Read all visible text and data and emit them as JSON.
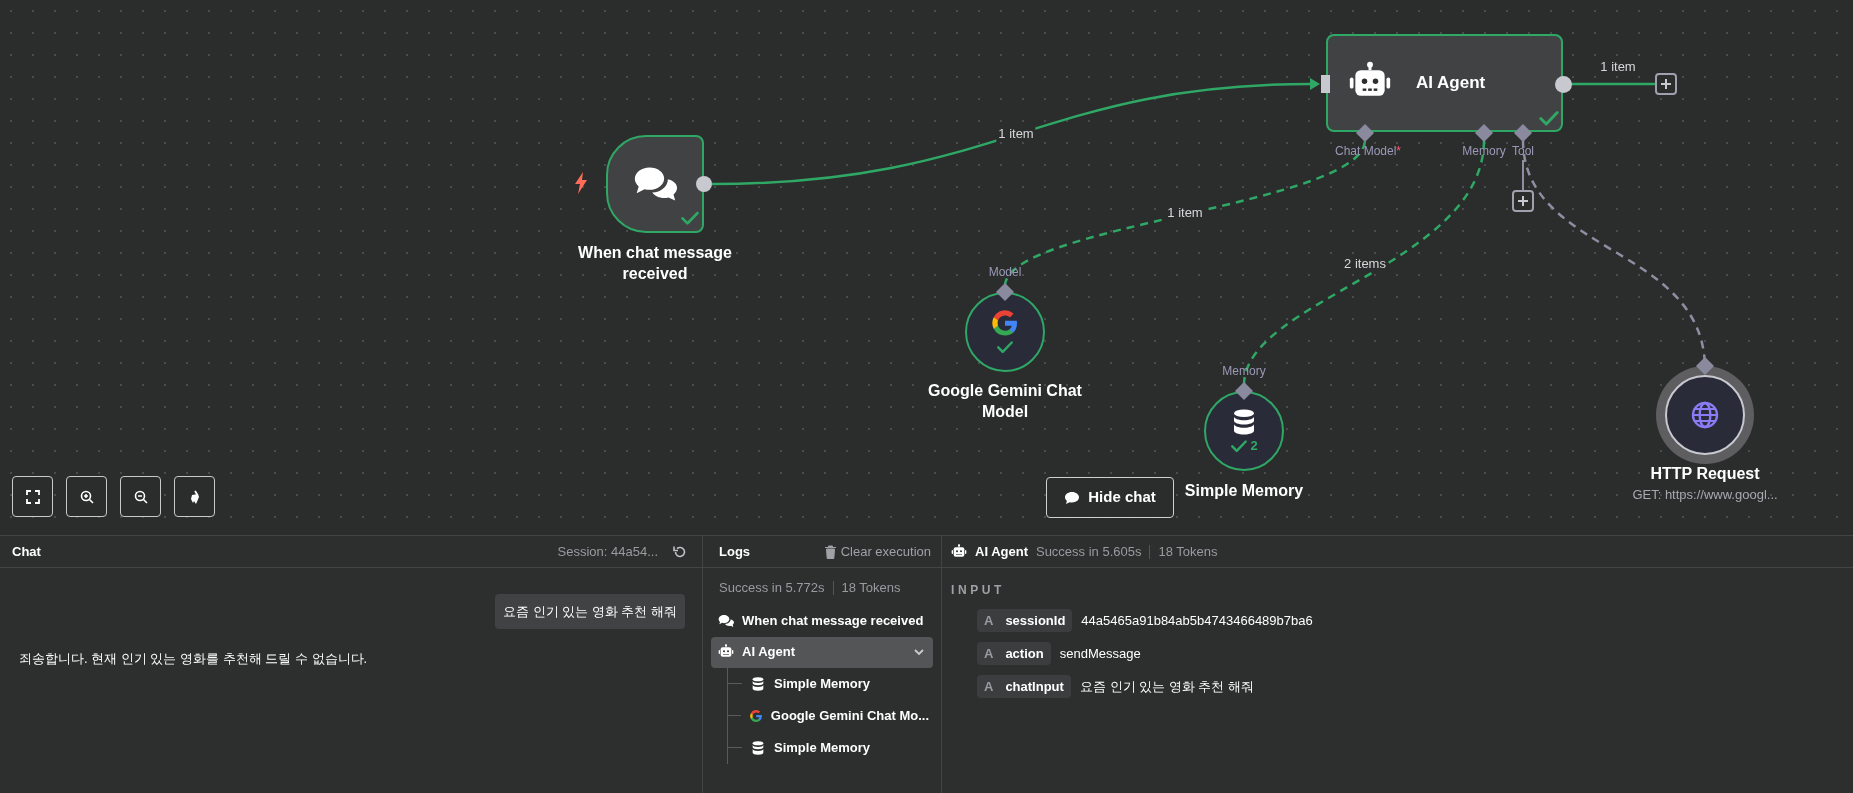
{
  "canvas": {
    "nodes": [
      {
        "kind": "trigger",
        "label": "When chat message received",
        "succeeded": true
      },
      {
        "kind": "agent",
        "label": "AI Agent",
        "succeeded": true,
        "inputs": [
          {
            "label": "Chat Model",
            "required_mark": "*"
          },
          {
            "label": "Memory"
          },
          {
            "label": "Tool"
          }
        ]
      },
      {
        "kind": "model",
        "label": "Google Gemini Chat Model",
        "handle_label": "Model",
        "succeeded": true
      },
      {
        "kind": "memory",
        "label": "Simple Memory",
        "handle_label": "Memory",
        "succeeded": true,
        "run_count": "2"
      },
      {
        "kind": "tool",
        "label": "HTTP Request",
        "subtitle": "GET: https://www.googl...",
        "succeeded": false
      }
    ],
    "connections": [
      {
        "label": "1 item",
        "active": true
      },
      {
        "label": "1 item",
        "active": true
      },
      {
        "label": "1 item",
        "active": true
      },
      {
        "label": "2 items",
        "active": true
      },
      {
        "active": false
      }
    ],
    "hide_chat_button": "Hide chat"
  },
  "chat_panel": {
    "title": "Chat",
    "session": "Session: 44a54...",
    "messages": [
      {
        "kind": "sent",
        "text": "요즘 인기 있는 영화 추천 해줘"
      },
      {
        "kind": "received",
        "text": "죄송합니다. 현재 인기 있는 영화를 추천해 드릴 수 없습니다."
      }
    ]
  },
  "logs_panel": {
    "title": "Logs",
    "clear_button": "Clear execution",
    "duration": "Success in 5.772s",
    "tokens": "18 Tokens",
    "tree": [
      {
        "kind": "chat",
        "label": "When chat message received",
        "selected": false
      },
      {
        "kind": "agent",
        "label": "AI Agent",
        "selected": true,
        "expanded": true,
        "children": [
          {
            "kind": "memory",
            "label": "Simple Memory",
            "selected": false
          },
          {
            "kind": "model",
            "label": "Google Gemini Chat Mo...",
            "selected": false
          },
          {
            "kind": "memory",
            "label": "Simple Memory",
            "selected": false
          }
        ]
      }
    ]
  },
  "run_panel": {
    "node": "AI Agent",
    "duration": "Success in 5.605s",
    "tokens": "18 Tokens",
    "section": "INPUT",
    "fields": [
      {
        "type": "A",
        "key": "sessionId",
        "value": "44a5465a91b84ab5b4743466489b7ba6"
      },
      {
        "type": "A",
        "key": "action",
        "value": "sendMessage"
      },
      {
        "type": "A",
        "key": "chatInput",
        "value": "요즘 인기 있는 영화 추천 해줘"
      }
    ]
  }
}
